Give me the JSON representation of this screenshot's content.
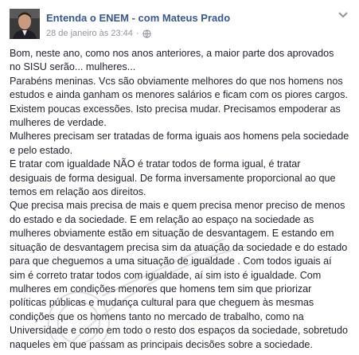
{
  "post": {
    "author": "Entenda o ENEM - com Mateus Prado",
    "timestamp": "28 de janeiro às 23:44",
    "separator": "·",
    "privacy_icon": "globe-icon",
    "options_icon": "chevron-down-icon",
    "lines": [
      "Bom, neste ano, como nos anos anteriores, a maior parte dos aprovados",
      "no SISU serão... mulheres...",
      "Parabéns meninas. Vcs são obviamente melhores do que nos homens nos",
      "estudos e ainda ganham os menores salários e ficam com os piores cargos.",
      "Existem poucas excessões. Isto precisa mudar. Precisamos empoderar as",
      "mulheres de verdade.",
      "Mulheres precisam ser tratadas de forma iguais aos homens pela sociedade",
      "e pelo estado.",
      "E tratar com igualdade NÃO é tratar todos de forma igual, é tratar",
      "desiguais de forma desigual. De forma inversamente proporcional ao que",
      "temos em relação aos direitos.",
      "Que precisa mais precisa de mais e quem precisa menor preciso de menos",
      "do estado e da sociedade. E em relação ao espaço na sociedade as",
      "mulheres obviamente estão em situação de desvantagem. E estando em",
      "situação de desvantagem precisa sim da atuação da sociedade e do estado",
      "para que cheguemos a uma situação de igualdade . Com todos iguais aí",
      "sim é correto tratar todos com igualdade, aí sim isto é igualdade. Com",
      "mulheres em condições menores que homens tem sim que priorizar",
      "políticas públicas e mudança cultural para que cheguem às mesmas",
      "condições que os homens tanto no mercado de trabalho, como na",
      "Universidade e como em todo o resto dos espaços da sociedade, sobretudo",
      "naqueles em que passam as principais decisões sobre a sociedade."
    ]
  },
  "colors": {
    "author": "#365899",
    "text": "#1d2129",
    "meta": "#90949c"
  }
}
